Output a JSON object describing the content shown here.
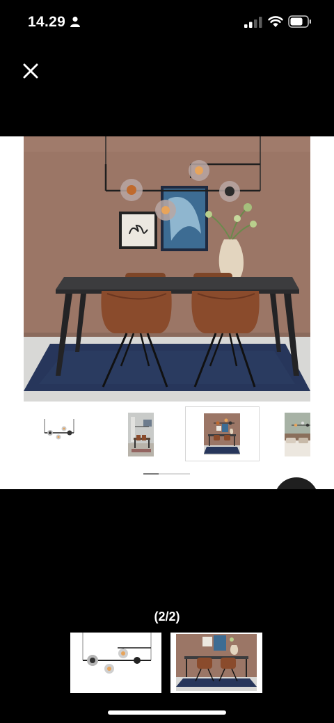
{
  "status_bar": {
    "time": "14.29",
    "icons": [
      "person-icon",
      "cellular-signal-icon",
      "wifi-icon",
      "battery-icon"
    ]
  },
  "viewer": {
    "close_icon": "close-icon",
    "image_counter": "(2/2)"
  },
  "product_gallery": {
    "selected_thumbnail": 3,
    "thumbnail_count": 4,
    "scroll_position": 0.33
  },
  "colors": {
    "wall": "#9b7666",
    "rug": "#27365b",
    "chair_leather": "#8a4b2c",
    "table_top": "#3c3c3e",
    "background": "#000000"
  }
}
